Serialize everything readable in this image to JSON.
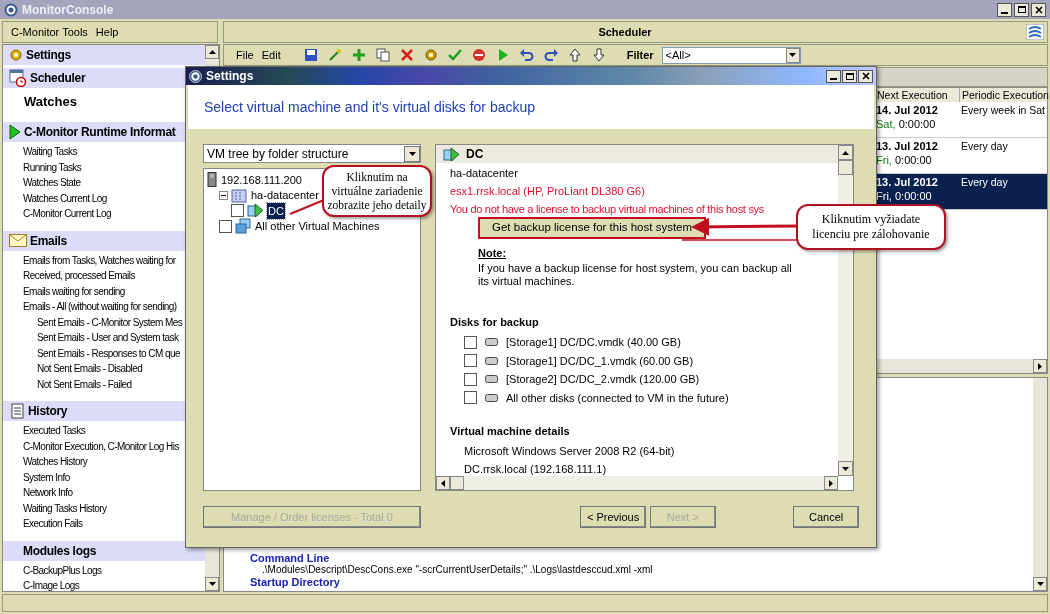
{
  "window": {
    "title": "MonitorConsole"
  },
  "menu": [
    "C-Monitor Tools",
    "Help"
  ],
  "sidebar": {
    "sections": [
      {
        "title": "Settings",
        "kind": "settings"
      },
      {
        "title": "Scheduler",
        "kind": "scheduler",
        "items": [
          {
            "label": "Watches",
            "kind": "subheader"
          }
        ]
      },
      {
        "title": "C-Monitor Runtime Informat",
        "kind": "runtime",
        "items": [
          {
            "label": "Waiting Tasks",
            "kind": "link"
          },
          {
            "label": "Running Tasks",
            "kind": "link"
          },
          {
            "label": "Watches State",
            "kind": "link"
          },
          {
            "label": "Watches Current Log",
            "kind": "link"
          },
          {
            "label": "C-Monitor Current Log",
            "kind": "link"
          }
        ]
      },
      {
        "title": "Emails",
        "kind": "emails",
        "items": [
          {
            "label": "Emails from Tasks, Watches waiting for",
            "kind": "link"
          },
          {
            "label": "Received, processed Emails",
            "kind": "link"
          },
          {
            "label": "Emails waiting for sending",
            "kind": "link"
          },
          {
            "label": "Emails - All (without waiting for sending)",
            "kind": "link",
            "children": [
              {
                "label": "Sent Emails - C-Monitor System Mes"
              },
              {
                "label": "Sent Emails - User and System task"
              },
              {
                "label": "Sent Emails - Responses to CM que"
              },
              {
                "label": "Not Sent Emails - Disabled"
              },
              {
                "label": "Not Sent Emails - Failed"
              }
            ]
          }
        ]
      },
      {
        "title": "History",
        "kind": "history",
        "items": [
          {
            "label": "Executed Tasks",
            "kind": "link"
          },
          {
            "label": "C-Monitor Execution, C-Monitor Log His",
            "kind": "link"
          },
          {
            "label": "Watches History",
            "kind": "link"
          },
          {
            "label": "System Info",
            "kind": "link"
          },
          {
            "label": "Network Info",
            "kind": "link"
          },
          {
            "label": "Waiting Tasks History",
            "kind": "link"
          },
          {
            "label": "Execution Fails",
            "kind": "link"
          }
        ]
      },
      {
        "title": "Modules logs",
        "kind": "plain",
        "items": [
          {
            "label": "C-BackupPlus Logs",
            "kind": "link"
          },
          {
            "label": "C-Image Logs",
            "kind": "link"
          }
        ]
      }
    ]
  },
  "main": {
    "title": "Scheduler",
    "toolbar_menu": [
      "File",
      "Edit"
    ],
    "filter": {
      "label": "Filter",
      "value": "<All>"
    },
    "table": {
      "columns": [
        "Next Execution",
        "Periodic Execution"
      ],
      "rows": [
        {
          "date": "14. Jul 2012",
          "day": "Sat,",
          "time": "0:00:00",
          "period": "Every week in Sat",
          "selected": false
        },
        {
          "date": "13. Jul 2012",
          "day": "Fri,",
          "time": "0:00:00",
          "period": "Every day",
          "selected": false
        },
        {
          "date": "13. Jul 2012",
          "day": "Fri,",
          "time": "0:00:00",
          "period": "Every day",
          "selected": true
        }
      ]
    },
    "details": [
      {
        "label": "Command Line",
        "value": ".\\Modules\\Descript\\DescCons.exe \"-scrCurrentUserDetails;\" .\\Logs\\lastdesccud.xml -xml"
      },
      {
        "label": "Startup Directory"
      }
    ]
  },
  "dialog": {
    "title": "Settings",
    "heading": "Select virtual machine and it's virtual disks for backup",
    "view": "VM tree by folder structure",
    "tree": [
      {
        "label": "192.168.111.200",
        "kind": "host",
        "children": [
          {
            "label": "ha-datacenter",
            "kind": "datacenter",
            "expanded": true,
            "children": [
              {
                "label": "DC",
                "kind": "vm",
                "checked": false,
                "selected": true
              }
            ]
          },
          {
            "label": "All other Virtual Machines",
            "kind": "vms",
            "checked": false,
            "selected": false
          }
        ]
      }
    ],
    "detail": {
      "title": "DC",
      "datacenter": "ha-datacenter",
      "host": "esx1.rrsk.local (HP, ProLiant DL380 G6)",
      "warning": "You do not have a license to backup virtual machines of this host sys",
      "license_button": "Get backup license for this host system",
      "note_label": "Note:",
      "note": "If you have a backup license for host system, you can backup all its virtual machines.",
      "disks_title": "Disks for backup",
      "disks": [
        {
          "label": "[Storage1] DC/DC.vmdk (40.00 GB)",
          "checked": false
        },
        {
          "label": "[Storage1] DC/DC_1.vmdk (60.00 GB)",
          "checked": false
        },
        {
          "label": "[Storage2] DC/DC_2.vmdk (120.00 GB)",
          "checked": false
        },
        {
          "label": "All other disks (connected to VM in the future)",
          "checked": false
        }
      ],
      "vm_title": "Virtual machine details",
      "vm_lines": [
        "Microsoft Windows Server 2008 R2 (64-bit)",
        "DC.rrsk.local (192.168.111.1)"
      ]
    },
    "buttons": [
      {
        "label": "Manage / Order licenses - Total 0",
        "disabled": true
      },
      {
        "label": "< Previous",
        "disabled": false
      },
      {
        "label": "Next >",
        "disabled": true
      },
      {
        "label": "Cancel",
        "disabled": false
      }
    ]
  },
  "callouts": [
    "Kliknutim na virtuálne zariadenie zobrazite jeho detaily",
    "Kliknutim vyžiadate licenciu pre zálohovanie"
  ]
}
